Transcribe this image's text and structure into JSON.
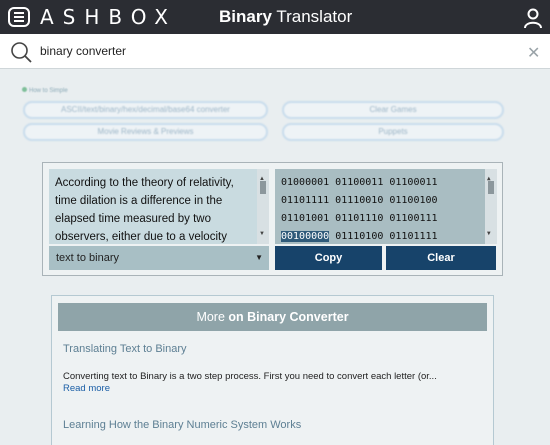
{
  "header": {
    "logo_text": "ASHBOX",
    "title_bold": "Binary",
    "title_rest": " Translator",
    "icons": [
      "menu-icon",
      "user-icon"
    ]
  },
  "search": {
    "value": "binary converter",
    "placeholder": "",
    "clear_symbol": "✕"
  },
  "related": {
    "howto_label": "How to Simple",
    "links": [
      "ASCII/text/binary/hex/decimal/base64 converter",
      "Clear Games",
      "Movie Reviews & Previews",
      "Puppets"
    ]
  },
  "translator": {
    "input_text": "According to the theory of relativity, time dilation is a difference in the elapsed time measured by two observers, either due to a velocity",
    "output_text_before": "01000001 01100011 01100011 01101111 01110010 01100100 01101001 01101110 01100111 ",
    "output_text_highlight": "00100000",
    "output_text_after": " 01110100 01101111",
    "mode": "text to binary",
    "copy_label": "Copy",
    "clear_label": "Clear"
  },
  "more": {
    "heading_prefix": "More ",
    "heading_bold": "on Binary Converter",
    "articles": [
      {
        "title": "Translating Text to Binary",
        "text": "Converting text to Binary is a two step process. First you need to convert each letter (or...",
        "link": "Read more"
      },
      {
        "title": "Learning How the Binary Numeric System Works"
      }
    ]
  },
  "colors": {
    "header_bg": "#2b2d33",
    "button_bg": "#17436a",
    "panel_head_bg": "#8fa4a9",
    "link": "#1b5fa6"
  }
}
